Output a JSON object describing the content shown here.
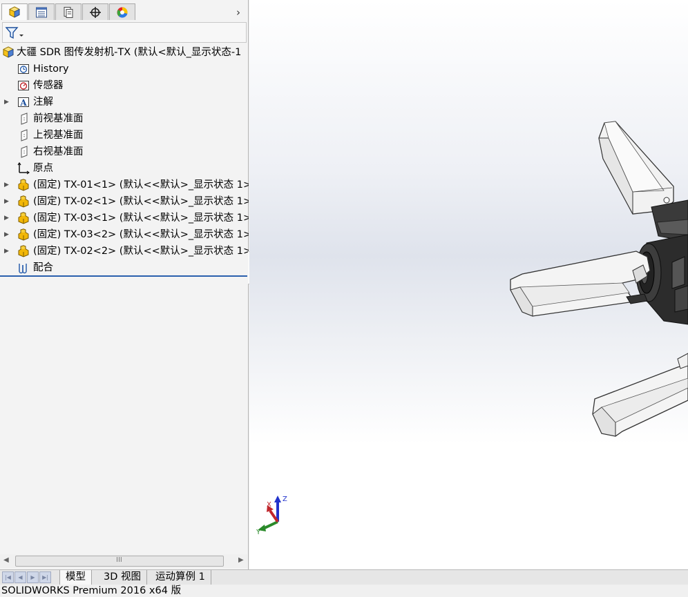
{
  "feature_manager": {
    "tabs": [
      {
        "icon": "feature-manager-icon",
        "active": true
      },
      {
        "icon": "property-manager-icon",
        "active": false
      },
      {
        "icon": "configuration-manager-icon",
        "active": false
      },
      {
        "icon": "dimxpert-manager-icon",
        "active": false
      },
      {
        "icon": "display-manager-icon",
        "active": false
      }
    ],
    "more_glyph": "›",
    "filter_icon": "filter-icon",
    "tree": {
      "root": "大疆 SDR 图传发射机-TX  (默认<默认_显示状态-1",
      "items": [
        {
          "label": "History",
          "icon": "history-icon",
          "expandable": false
        },
        {
          "label": "传感器",
          "icon": "sensors-icon",
          "expandable": false
        },
        {
          "label": "注解",
          "icon": "annotations-icon",
          "expandable": true
        },
        {
          "label": "前视基准面",
          "icon": "plane-icon",
          "expandable": false
        },
        {
          "label": "上视基准面",
          "icon": "plane-icon",
          "expandable": false
        },
        {
          "label": "右视基准面",
          "icon": "plane-icon",
          "expandable": false
        },
        {
          "label": "原点",
          "icon": "origin-icon",
          "expandable": false
        },
        {
          "label": "(固定) TX-01<1> (默认<<默认>_显示状态 1>",
          "icon": "part-icon",
          "expandable": true
        },
        {
          "label": "(固定) TX-02<1> (默认<<默认>_显示状态 1>",
          "icon": "part-icon",
          "expandable": true
        },
        {
          "label": "(固定) TX-03<1> (默认<<默认>_显示状态 1>",
          "icon": "part-icon",
          "expandable": true
        },
        {
          "label": "(固定) TX-03<2> (默认<<默认>_显示状态 1>",
          "icon": "part-icon",
          "expandable": true
        },
        {
          "label": "(固定) TX-02<2> (默认<<默认>_显示状态 1>",
          "icon": "part-icon",
          "expandable": true
        },
        {
          "label": "配合",
          "icon": "mates-icon",
          "expandable": false
        }
      ]
    },
    "hscroll": {
      "left": "◀",
      "right": "▶",
      "grip": "III"
    }
  },
  "triad": {
    "x": "X",
    "y": "Y",
    "z": "Z"
  },
  "bottom_tabs": {
    "nav": [
      "|◀",
      "◀",
      "▶",
      "▶|"
    ],
    "tabs": [
      {
        "label": "模型",
        "active": true
      },
      {
        "label": "3D 视图",
        "active": false
      },
      {
        "label": "运动算例 1",
        "active": false
      }
    ]
  },
  "status_bar": {
    "text": "SOLIDWORKS Premium 2016 x64 版"
  },
  "colors": {
    "accent": "#2a5fad",
    "part_icon": "#f2b707",
    "axis_x": "#c0262c",
    "axis_y": "#2a8a2a",
    "axis_z": "#2233cc"
  }
}
